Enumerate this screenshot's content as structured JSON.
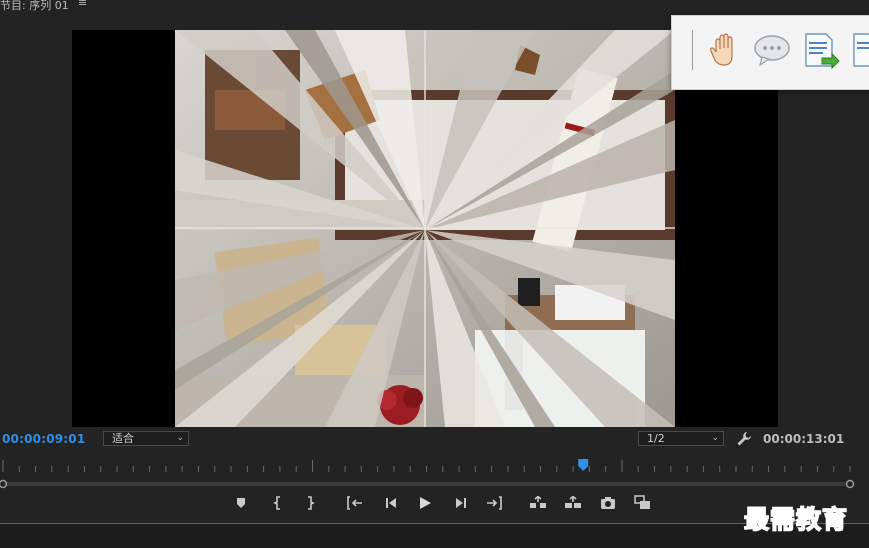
{
  "panel": {
    "title": "节目: 序列 01",
    "menu_glyph": "≡"
  },
  "program_monitor": {
    "current_time": "00:00:09:01",
    "zoom_level": "适合",
    "resolution": "1/2",
    "duration": "00:00:13:01",
    "playhead_position_fraction": 0.685
  },
  "floating_toolbar": {
    "icons": [
      "hand-tool-icon",
      "comment-bubble-icon",
      "export-document-icon",
      "document-icon"
    ]
  },
  "transport_controls": [
    "add-marker-icon",
    "mark-in-icon",
    "mark-out-icon",
    "go-to-in-icon",
    "step-back-icon",
    "play-icon",
    "step-forward-icon",
    "go-to-out-icon",
    "lift-icon",
    "extract-icon",
    "export-frame-icon",
    "button-editor-icon"
  ],
  "watermark": {
    "text": "最需教育"
  },
  "colors": {
    "timecode_accent": "#2f8fe8",
    "panel_bg": "#232323",
    "watermark": "#2236a8"
  }
}
